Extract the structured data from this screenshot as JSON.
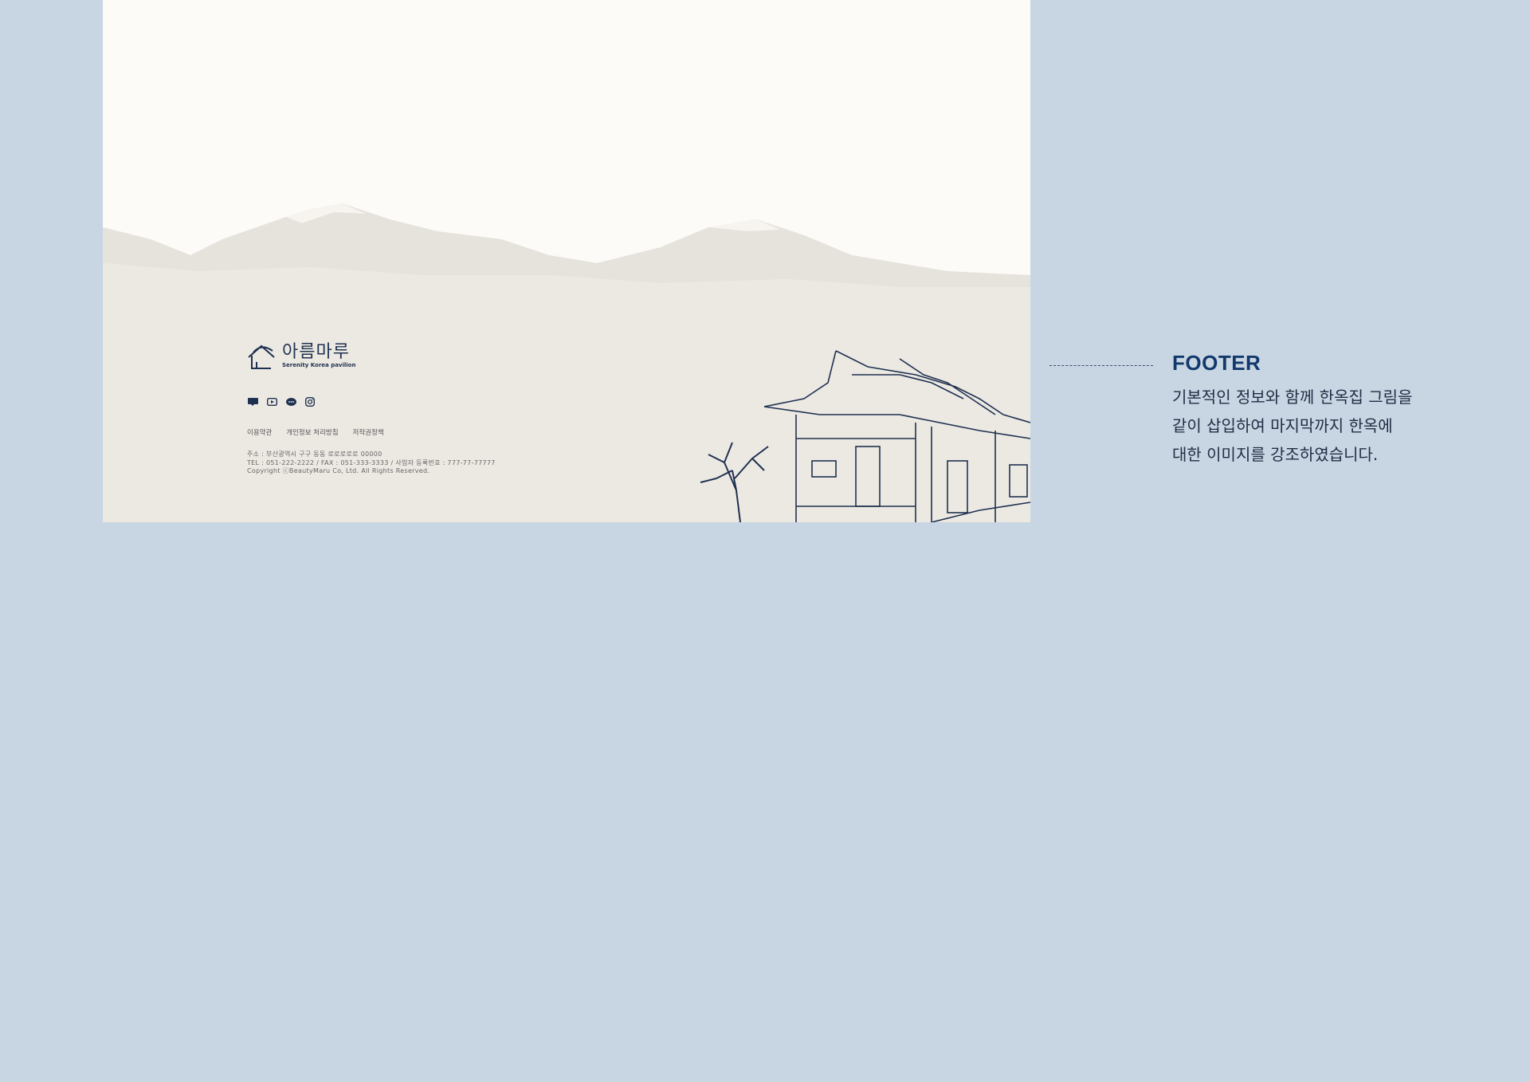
{
  "logo": {
    "name": "아름마루",
    "tagline": "Serenity Korea pavilion"
  },
  "socials": [
    {
      "icon": "blog-icon"
    },
    {
      "icon": "youtube-icon"
    },
    {
      "icon": "kakaotalk-icon"
    },
    {
      "icon": "instagram-icon"
    }
  ],
  "footer_links": [
    "이용약관",
    "개인정보 처리방침",
    "저작권정책"
  ],
  "info": {
    "address": "주소 : 부산광역시 구구 동동 로로로로로 00000",
    "contact": "TEL : 051-222-2222 / FAX : 051-333-3333 / 사업자 등록번호 : 777-77-77777",
    "copyright": "Copyright ⓒBeautyMaru Co, Ltd. All Rights Reserved."
  },
  "callout": {
    "title": "FOOTER",
    "lines": [
      "기본적인 정보와 함께 한옥집 그림을",
      "같이 삽입하여 마지막까지 한옥에",
      "대한 이미지를 강조하였습니다."
    ]
  },
  "colors": {
    "background": "#c8d5e2",
    "panel": "#fdfbf7",
    "navy": "#1f3150",
    "title": "#12396b"
  }
}
